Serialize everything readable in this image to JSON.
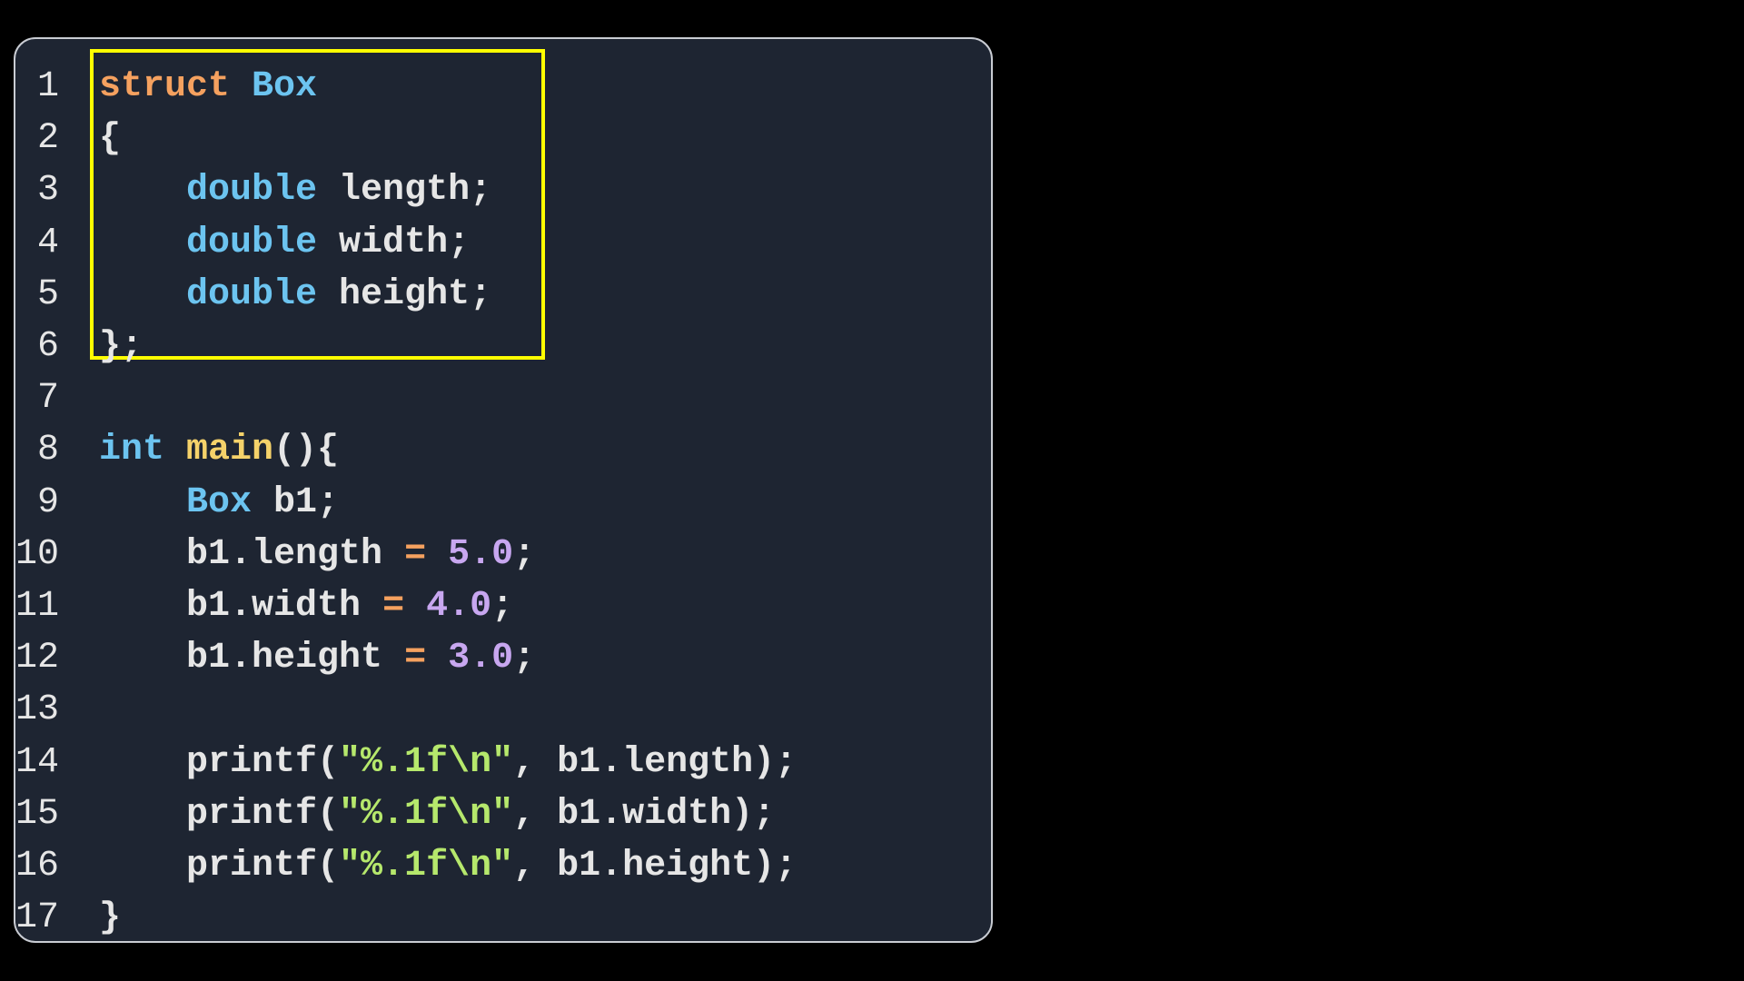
{
  "editor": {
    "lines": [
      {
        "number": "1",
        "tokens": [
          [
            "kw-struct",
            "struct"
          ],
          [
            "ident",
            " "
          ],
          [
            "kw-type",
            "Box"
          ]
        ]
      },
      {
        "number": "2",
        "tokens": [
          [
            "ident",
            "{"
          ]
        ]
      },
      {
        "number": "3",
        "tokens": [
          [
            "ident",
            "    "
          ],
          [
            "kw-type",
            "double"
          ],
          [
            "ident",
            " length;"
          ]
        ]
      },
      {
        "number": "4",
        "tokens": [
          [
            "ident",
            "    "
          ],
          [
            "kw-type",
            "double"
          ],
          [
            "ident",
            " width;"
          ]
        ]
      },
      {
        "number": "5",
        "tokens": [
          [
            "ident",
            "    "
          ],
          [
            "kw-type",
            "double"
          ],
          [
            "ident",
            " height;"
          ]
        ]
      },
      {
        "number": "6",
        "tokens": [
          [
            "ident",
            "};"
          ]
        ]
      },
      {
        "number": "7",
        "tokens": []
      },
      {
        "number": "8",
        "tokens": [
          [
            "kw-int",
            "int"
          ],
          [
            "ident",
            " "
          ],
          [
            "fn",
            "main"
          ],
          [
            "ident",
            "(){"
          ]
        ]
      },
      {
        "number": "9",
        "tokens": [
          [
            "ident",
            "    "
          ],
          [
            "kw-type",
            "Box"
          ],
          [
            "ident",
            " b1;"
          ]
        ]
      },
      {
        "number": "10",
        "tokens": [
          [
            "ident",
            "    b1.length "
          ],
          [
            "op",
            "="
          ],
          [
            "ident",
            " "
          ],
          [
            "num",
            "5.0"
          ],
          [
            "ident",
            ";"
          ]
        ]
      },
      {
        "number": "11",
        "tokens": [
          [
            "ident",
            "    b1.width "
          ],
          [
            "op",
            "="
          ],
          [
            "ident",
            " "
          ],
          [
            "num",
            "4.0"
          ],
          [
            "ident",
            ";"
          ]
        ]
      },
      {
        "number": "12",
        "tokens": [
          [
            "ident",
            "    b1.height "
          ],
          [
            "op",
            "="
          ],
          [
            "ident",
            " "
          ],
          [
            "num",
            "3.0"
          ],
          [
            "ident",
            ";"
          ]
        ]
      },
      {
        "number": "13",
        "tokens": []
      },
      {
        "number": "14",
        "tokens": [
          [
            "ident",
            "    printf("
          ],
          [
            "str",
            "\"%.1f\\n\""
          ],
          [
            "ident",
            ", b1.length);"
          ]
        ]
      },
      {
        "number": "15",
        "tokens": [
          [
            "ident",
            "    printf("
          ],
          [
            "str",
            "\"%.1f\\n\""
          ],
          [
            "ident",
            ", b1.width);"
          ]
        ]
      },
      {
        "number": "16",
        "tokens": [
          [
            "ident",
            "    printf("
          ],
          [
            "str",
            "\"%.1f\\n\""
          ],
          [
            "ident",
            ", b1.height);"
          ]
        ]
      },
      {
        "number": "17",
        "tokens": [
          [
            "ident",
            "}"
          ]
        ]
      }
    ]
  },
  "colors": {
    "background": "#000000",
    "editor_background": "#1e2532",
    "editor_border": "#c9ccd3",
    "highlight": "#ffff00",
    "keyword_struct": "#f5a15f",
    "type": "#6cc4f0",
    "function": "#f5d26a",
    "number": "#c8a7f0",
    "operator": "#f5a15f",
    "string": "#b6e86c",
    "text": "#e6e6e6"
  }
}
